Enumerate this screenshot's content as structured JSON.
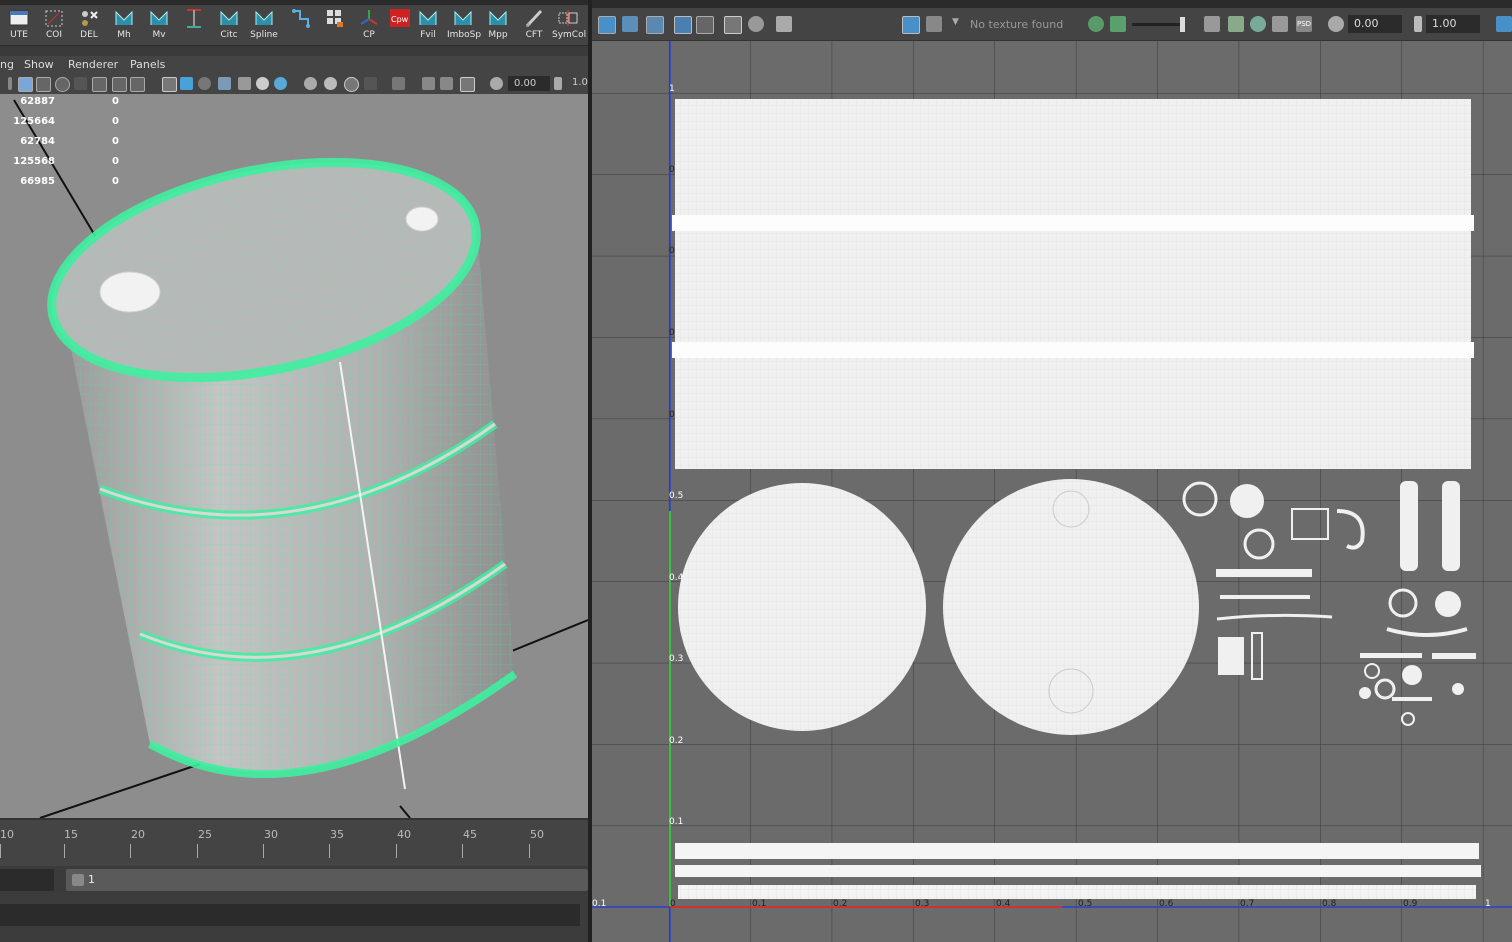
{
  "shelf": {
    "buttons": [
      {
        "label": "UTE",
        "icon": "window-icon"
      },
      {
        "label": "COI",
        "icon": "box-select-icon"
      },
      {
        "label": "DEL",
        "icon": "delete-icon"
      },
      {
        "label": "Mh",
        "icon": "maya-script-icon"
      },
      {
        "label": "Mv",
        "icon": "maya-script-icon"
      },
      {
        "label": "",
        "icon": "ruler-icon"
      },
      {
        "label": "Citc",
        "icon": "maya-script-icon"
      },
      {
        "label": "Spline",
        "icon": "maya-script-icon"
      },
      {
        "label": "",
        "icon": "path-icon"
      },
      {
        "label": "",
        "icon": "grid-bucket-icon"
      },
      {
        "label": "CP",
        "icon": "axis-icon"
      },
      {
        "label": "",
        "icon": "cpw-icon",
        "text": "Cpw"
      },
      {
        "label": "Fvil",
        "icon": "maya-script-icon"
      },
      {
        "label": "ImboSp",
        "icon": "maya-script-icon"
      },
      {
        "label": "Mpp",
        "icon": "maya-script-icon"
      },
      {
        "label": "CFT",
        "icon": "pencil-icon"
      },
      {
        "label": "SymCol",
        "icon": "symmetry-icon"
      }
    ]
  },
  "viewport": {
    "menu": [
      "ng",
      "Show",
      "Renderer",
      "Panels"
    ],
    "field_value": "0.00",
    "field_value_2": "1.0",
    "stats": [
      {
        "value": "62887",
        "second": "0"
      },
      {
        "value": "125664",
        "second": "0"
      },
      {
        "value": "62784",
        "second": "0"
      },
      {
        "value": "125568",
        "second": "0"
      },
      {
        "value": "66985",
        "second": "0"
      }
    ]
  },
  "timeline": {
    "ticks": [
      "10",
      "15",
      "20",
      "25",
      "30",
      "35",
      "40",
      "45",
      "50"
    ],
    "range_value": "1"
  },
  "uv_editor": {
    "texture_status": "No texture found",
    "field_1": "0.00",
    "field_2": "1.00",
    "v_axis_labels": [
      "1",
      "0",
      "0",
      "0",
      "0",
      "0.5",
      "0.4",
      "0.3",
      "0.2",
      "0.1"
    ],
    "u_axis_labels": [
      "0.1",
      "0",
      "0.1",
      "0.2",
      "0.3",
      "0.4",
      "0.5",
      "0.6",
      "0.7",
      "0.8",
      "0.9",
      "1"
    ]
  },
  "colors": {
    "wireframe": "#3ef0a0",
    "viewport_bg": "#8d8d8d",
    "uv_bg": "#6b6b6b",
    "uv_shell": "#f0f0f0",
    "v_axis": "#3fbf3f",
    "u_axis": "#d03030",
    "uv_boundary": "#2a3fd0"
  }
}
